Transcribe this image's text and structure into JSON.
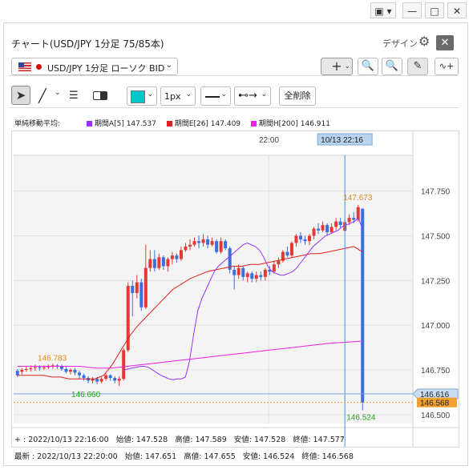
{
  "window": {
    "dropdown_icon": "window-menu-icon",
    "controls": [
      "minimize",
      "restore",
      "close"
    ]
  },
  "header": {
    "title": "チャート(USD/JPY 1分足 75/85本)",
    "design_label": "デザイン"
  },
  "toolbar": {
    "symbol_label": "USD/JPY 1分足 ローソク BID",
    "color_value": "#00c8c8",
    "width_value": "1px",
    "clear_label": "全削除"
  },
  "legend": {
    "label": "単純移動平均:",
    "items": [
      {
        "label": "期間A[5] 147.537",
        "color": "#9b30ff"
      },
      {
        "label": "期間E[26] 147.409",
        "color": "#e02020"
      },
      {
        "label": "期間H[200] 146.911",
        "color": "#e820e8"
      }
    ]
  },
  "info": {
    "cursor_prefix": "+ : 2022/10/13 22:16:00",
    "cursor_open": "始値: 147.528",
    "cursor_high": "高値: 147.589",
    "cursor_low": "安値: 147.528",
    "cursor_close": "終値: 147.577",
    "latest_prefix": "最新 : 2022/10/13 22:20:00",
    "latest_open": "始値: 147.651",
    "latest_high": "高値: 147.655",
    "latest_low": "安値: 146.524",
    "latest_close": "終値: 146.568"
  },
  "chart_data": {
    "type": "candlestick",
    "y_ticks": [
      "147.750",
      "147.500",
      "147.250",
      "147.000",
      "146.750",
      "146.500"
    ],
    "ylim": [
      146.45,
      147.95
    ],
    "time_label": "22:00",
    "cursor_time_label": "10/13 22:16",
    "annotations": {
      "high": "147.673",
      "low": "146.524",
      "left_high": "146.783",
      "left_low": "146.660"
    },
    "price_tags": {
      "line": "146.616",
      "last": "146.568"
    },
    "candles": [
      [
        146.745,
        146.72,
        146.71,
        146.755
      ],
      [
        146.74,
        146.75,
        146.725,
        146.76
      ],
      [
        146.75,
        146.755,
        146.74,
        146.77
      ],
      [
        146.755,
        146.76,
        146.74,
        146.775
      ],
      [
        146.76,
        146.765,
        146.745,
        146.78
      ],
      [
        146.765,
        146.76,
        146.745,
        146.775
      ],
      [
        146.76,
        146.765,
        146.75,
        146.775
      ],
      [
        146.765,
        146.77,
        146.755,
        146.78
      ],
      [
        146.77,
        146.775,
        146.755,
        146.785
      ],
      [
        146.775,
        146.77,
        146.755,
        146.783
      ],
      [
        146.77,
        146.755,
        146.745,
        146.78
      ],
      [
        146.755,
        146.74,
        146.73,
        146.765
      ],
      [
        146.74,
        146.75,
        146.725,
        146.76
      ],
      [
        146.75,
        146.735,
        146.72,
        146.76
      ],
      [
        146.735,
        146.72,
        146.7,
        146.745
      ],
      [
        146.72,
        146.705,
        146.69,
        146.73
      ],
      [
        146.705,
        146.69,
        146.675,
        146.715
      ],
      [
        146.69,
        146.7,
        146.675,
        146.71
      ],
      [
        146.7,
        146.685,
        146.67,
        146.71
      ],
      [
        146.685,
        146.7,
        146.675,
        146.71
      ],
      [
        146.7,
        146.72,
        146.69,
        146.73
      ],
      [
        146.72,
        146.705,
        146.69,
        146.725
      ],
      [
        146.705,
        146.69,
        146.675,
        146.715
      ],
      [
        146.69,
        146.7,
        146.66,
        146.715
      ],
      [
        146.7,
        146.86,
        146.69,
        146.87
      ],
      [
        146.86,
        147.22,
        146.85,
        147.24
      ],
      [
        147.22,
        147.18,
        147.05,
        147.25
      ],
      [
        147.18,
        147.24,
        147.15,
        147.28
      ],
      [
        147.24,
        147.1,
        147.08,
        147.26
      ],
      [
        147.1,
        147.32,
        147.09,
        147.45
      ],
      [
        147.32,
        147.37,
        147.3,
        147.42
      ],
      [
        147.37,
        147.32,
        147.3,
        147.42
      ],
      [
        147.32,
        147.38,
        147.31,
        147.4
      ],
      [
        147.38,
        147.33,
        147.31,
        147.39
      ],
      [
        147.33,
        147.37,
        147.3,
        147.38
      ],
      [
        147.37,
        147.39,
        147.34,
        147.41
      ],
      [
        147.39,
        147.37,
        147.35,
        147.4
      ],
      [
        147.37,
        147.42,
        147.36,
        147.44
      ],
      [
        147.42,
        147.44,
        147.41,
        147.46
      ],
      [
        147.44,
        147.45,
        147.42,
        147.48
      ],
      [
        147.45,
        147.47,
        147.44,
        147.49
      ],
      [
        147.47,
        147.46,
        147.43,
        147.5
      ],
      [
        147.46,
        147.48,
        147.44,
        147.51
      ],
      [
        147.48,
        147.45,
        147.43,
        147.5
      ],
      [
        147.45,
        147.47,
        147.44,
        147.49
      ],
      [
        147.47,
        147.41,
        147.4,
        147.48
      ],
      [
        147.41,
        147.47,
        147.4,
        147.49
      ],
      [
        147.47,
        147.43,
        147.42,
        147.48
      ],
      [
        147.43,
        147.31,
        147.29,
        147.44
      ],
      [
        147.31,
        147.28,
        147.2,
        147.33
      ],
      [
        147.28,
        147.32,
        147.26,
        147.34
      ],
      [
        147.32,
        147.27,
        147.25,
        147.33
      ],
      [
        147.27,
        147.29,
        147.24,
        147.3
      ],
      [
        147.29,
        147.26,
        147.24,
        147.3
      ],
      [
        147.26,
        147.28,
        147.24,
        147.3
      ],
      [
        147.28,
        147.27,
        147.25,
        147.3
      ],
      [
        147.27,
        147.31,
        147.25,
        147.32
      ],
      [
        147.31,
        147.3,
        147.28,
        147.33
      ],
      [
        147.3,
        147.34,
        147.29,
        147.36
      ],
      [
        147.34,
        147.36,
        147.32,
        147.38
      ],
      [
        147.36,
        147.41,
        147.35,
        147.42
      ],
      [
        147.41,
        147.39,
        147.38,
        147.44
      ],
      [
        147.39,
        147.46,
        147.38,
        147.47
      ],
      [
        147.46,
        147.5,
        147.44,
        147.51
      ],
      [
        147.5,
        147.48,
        147.46,
        147.52
      ],
      [
        147.48,
        147.47,
        147.45,
        147.5
      ],
      [
        147.47,
        147.5,
        147.45,
        147.51
      ],
      [
        147.5,
        147.54,
        147.48,
        147.55
      ],
      [
        147.54,
        147.53,
        147.51,
        147.57
      ],
      [
        147.53,
        147.56,
        147.52,
        147.58
      ],
      [
        147.56,
        147.52,
        147.5,
        147.57
      ],
      [
        147.52,
        147.55,
        147.51,
        147.57
      ],
      [
        147.55,
        147.58,
        147.53,
        147.6
      ],
      [
        147.58,
        147.56,
        147.54,
        147.6
      ],
      [
        147.528,
        147.577,
        147.528,
        147.589
      ],
      [
        147.577,
        147.6,
        147.56,
        147.62
      ],
      [
        147.6,
        147.59,
        147.57,
        147.63
      ],
      [
        147.59,
        147.66,
        147.58,
        147.673
      ],
      [
        147.651,
        146.568,
        146.524,
        147.655
      ]
    ],
    "ma_short": [
      146.75,
      146.755,
      146.76,
      146.765,
      146.77,
      146.77,
      146.765,
      146.75,
      146.735,
      146.72,
      146.71,
      146.7,
      146.695,
      146.7,
      146.7,
      146.71,
      146.8,
      146.95,
      147.08,
      147.15,
      147.2,
      147.25,
      147.3,
      147.33,
      147.35,
      147.37,
      147.39,
      147.41,
      147.43,
      147.45,
      147.46,
      147.45,
      147.44,
      147.42,
      147.38,
      147.33,
      147.3,
      147.29,
      147.28,
      147.28,
      147.29,
      147.3,
      147.32,
      147.35,
      147.38,
      147.41,
      147.44,
      147.46,
      147.48,
      147.5,
      147.51,
      147.52,
      147.53,
      147.55,
      147.56,
      147.57,
      147.58,
      147.6,
      147.537
    ],
    "ma_mid": [
      146.72,
      146.72,
      146.72,
      146.72,
      146.71,
      146.71,
      146.7,
      146.7,
      146.7,
      146.7,
      146.72,
      146.78,
      146.86,
      146.94,
      147.0,
      147.05,
      147.1,
      147.15,
      147.2,
      147.23,
      147.26,
      147.28,
      147.3,
      147.31,
      147.32,
      147.33,
      147.33,
      147.34,
      147.34,
      147.35,
      147.36,
      147.37,
      147.38,
      147.39,
      147.4,
      147.4,
      147.41,
      147.42,
      147.43,
      147.44,
      147.409
    ],
    "ma_long": [
      146.77,
      146.77,
      146.77,
      146.77,
      146.77,
      146.76,
      146.76,
      146.77,
      146.78,
      146.79,
      146.8,
      146.81,
      146.82,
      146.83,
      146.84,
      146.85,
      146.86,
      146.87,
      146.88,
      146.89,
      146.9,
      146.905,
      146.911
    ]
  }
}
